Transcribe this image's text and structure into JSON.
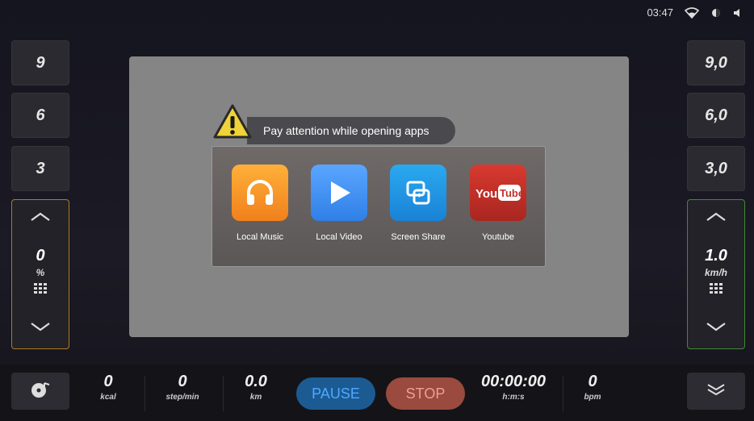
{
  "status_bar": {
    "time": "03:47",
    "icons": [
      "wifi-icon",
      "brightness-icon",
      "volume-icon"
    ]
  },
  "incline_presets": [
    "9",
    "6",
    "3"
  ],
  "speed_presets": [
    "9,0",
    "6,0",
    "3,0"
  ],
  "incline_control": {
    "value": "0",
    "unit": "%",
    "accent": "#b07d1a"
  },
  "speed_control": {
    "value": "1.0",
    "unit": "km/h",
    "accent": "#3f8a35"
  },
  "dialog": {
    "warning_text": "Pay attention while opening apps",
    "apps": [
      {
        "label": "Local Music",
        "icon": "headphones-icon",
        "color": "#f5962a"
      },
      {
        "label": "Local Video",
        "icon": "play-icon",
        "color": "#3a8ff0"
      },
      {
        "label": "Screen Share",
        "icon": "screen-share-icon",
        "color": "#1e8ee0"
      },
      {
        "label": "Youtube",
        "icon": "youtube-icon",
        "color": "#c4302b"
      }
    ]
  },
  "bottom_bar": {
    "stats": [
      {
        "value": "0",
        "unit": "kcal"
      },
      {
        "value": "0",
        "unit": "step/min"
      },
      {
        "value": "0.0",
        "unit": "km"
      },
      {
        "value": "00:00:00",
        "unit": "h:m:s"
      },
      {
        "value": "0",
        "unit": "bpm"
      }
    ],
    "pause_label": "PAUSE",
    "stop_label": "STOP"
  }
}
